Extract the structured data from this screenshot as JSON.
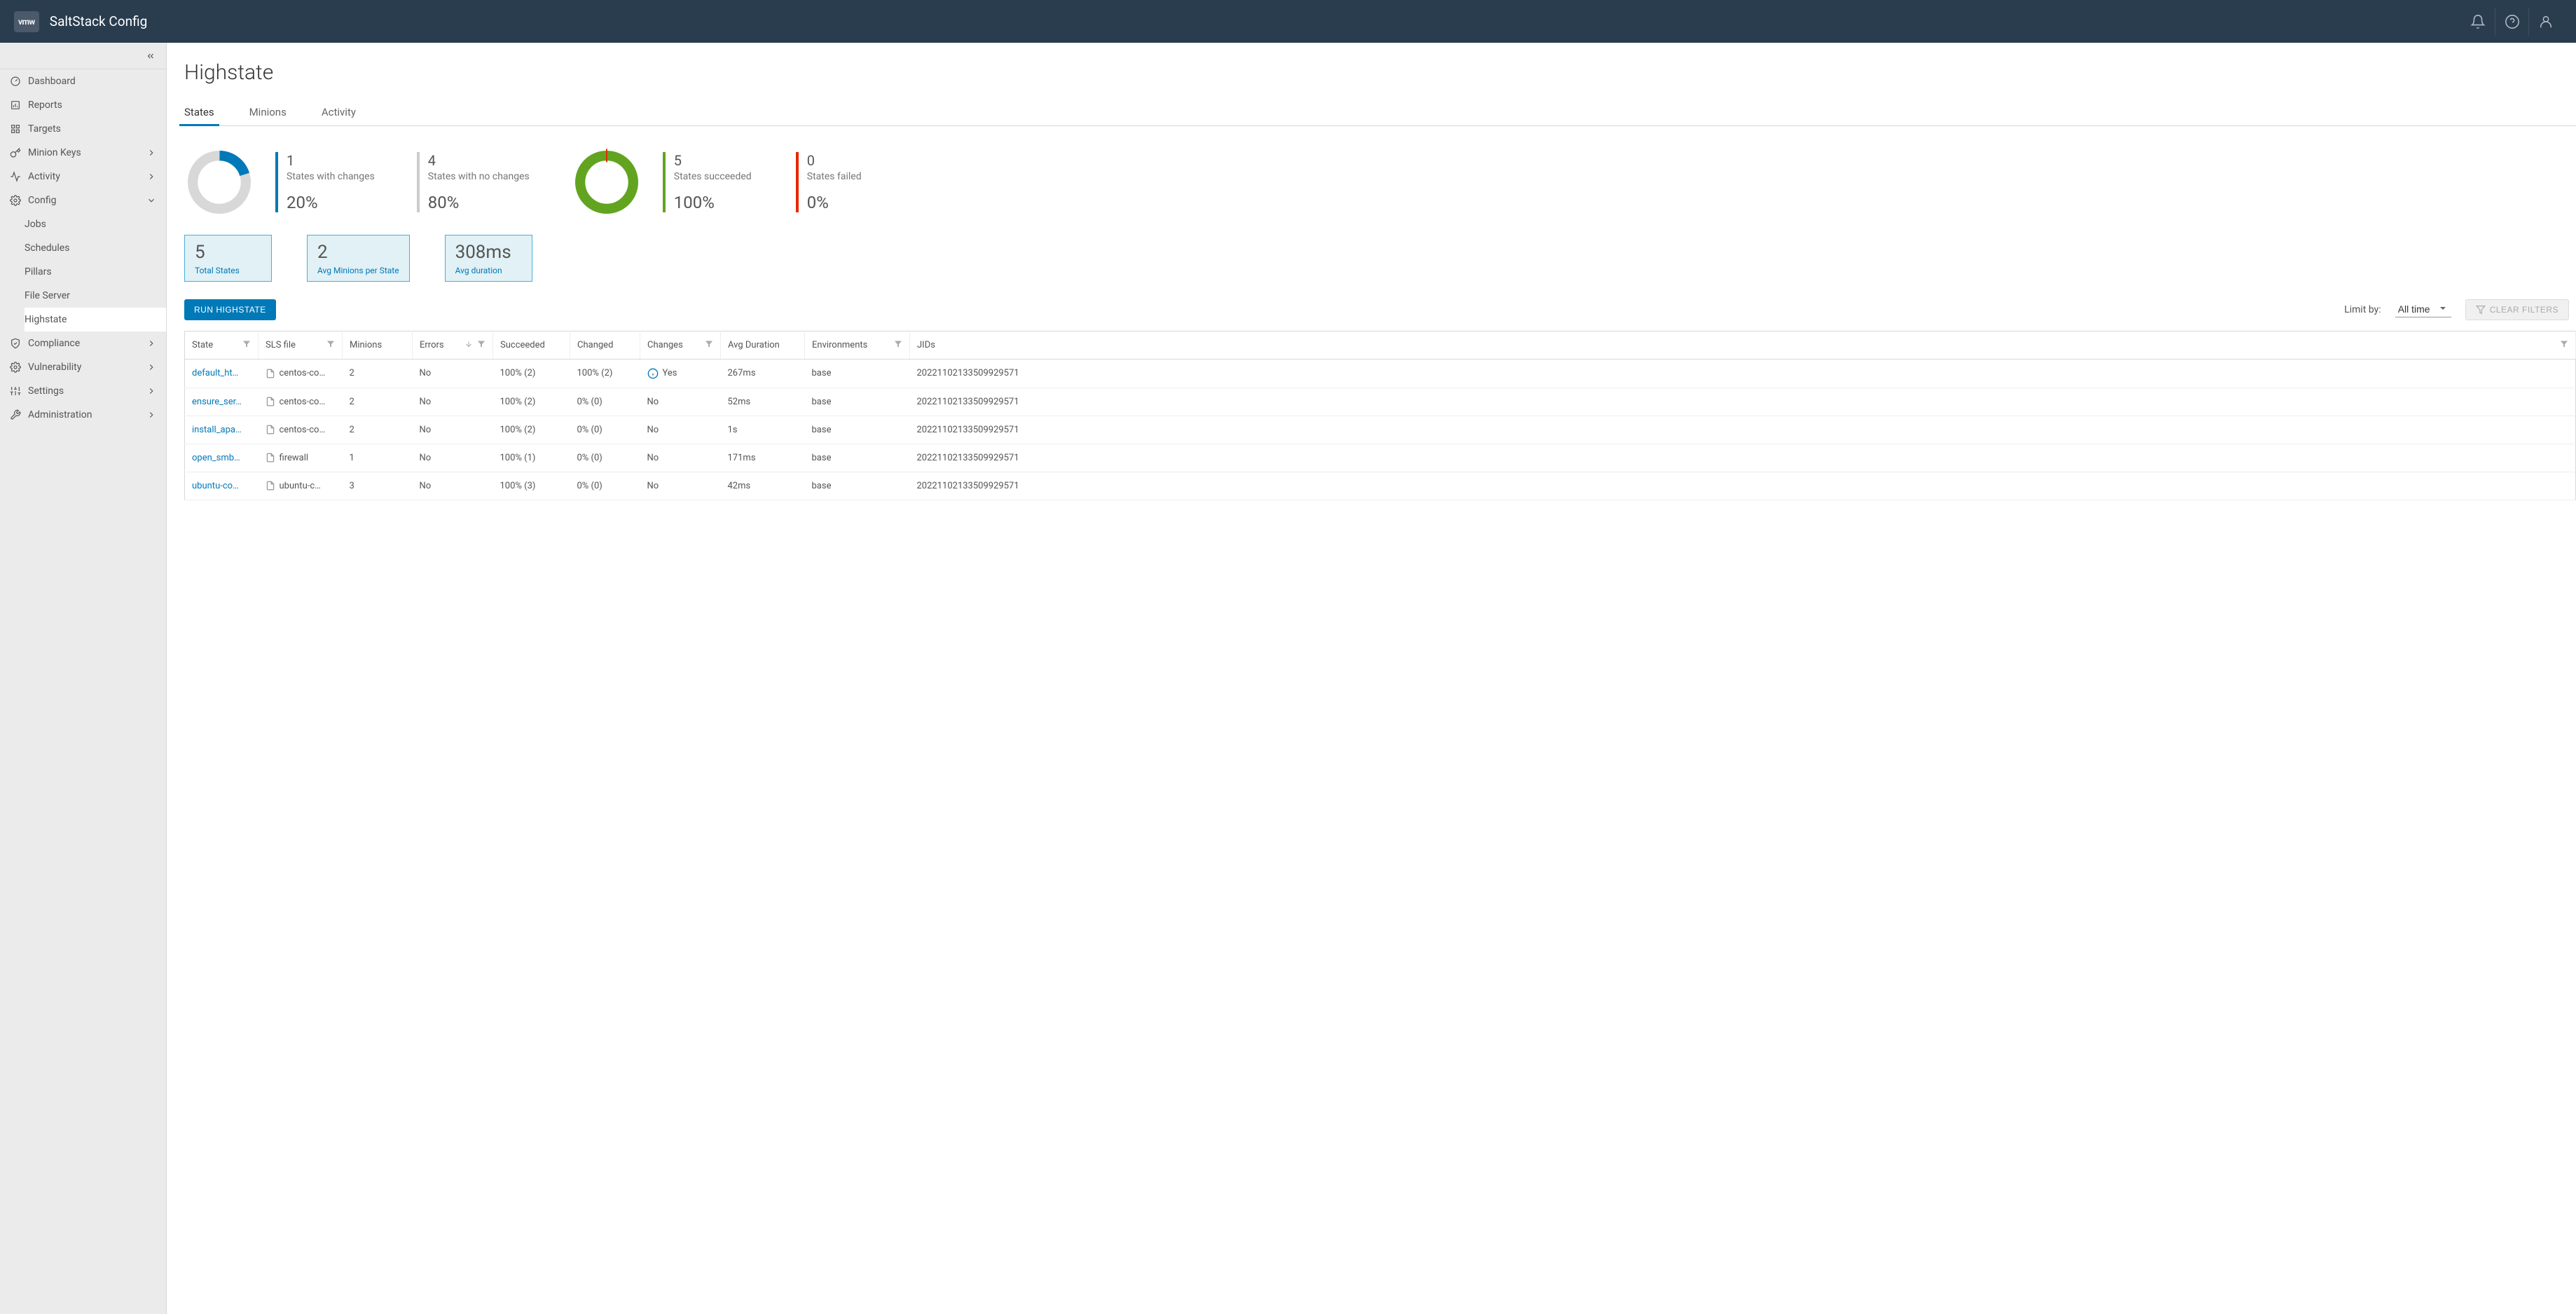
{
  "header": {
    "logo": "vmw",
    "title": "SaltStack Config"
  },
  "sidebar": {
    "items": [
      {
        "label": "Dashboard",
        "icon": "gauge"
      },
      {
        "label": "Reports",
        "icon": "report"
      },
      {
        "label": "Targets",
        "icon": "grid"
      },
      {
        "label": "Minion Keys",
        "icon": "key",
        "expandable": true
      },
      {
        "label": "Activity",
        "icon": "activity",
        "expandable": true
      },
      {
        "label": "Config",
        "icon": "cog",
        "expanded": true,
        "children": [
          {
            "label": "Jobs"
          },
          {
            "label": "Schedules"
          },
          {
            "label": "Pillars"
          },
          {
            "label": "File Server"
          },
          {
            "label": "Highstate",
            "active": true
          }
        ]
      },
      {
        "label": "Compliance",
        "icon": "shield",
        "expandable": true
      },
      {
        "label": "Vulnerability",
        "icon": "cog",
        "expandable": true
      },
      {
        "label": "Settings",
        "icon": "sliders",
        "expandable": true
      },
      {
        "label": "Administration",
        "icon": "wrench",
        "expandable": true
      }
    ]
  },
  "page": {
    "title": "Highstate"
  },
  "tabs": [
    {
      "label": "States",
      "active": true
    },
    {
      "label": "Minions"
    },
    {
      "label": "Activity"
    }
  ],
  "chart_data": [
    {
      "type": "pie",
      "title": "States changes",
      "categories": [
        "With changes",
        "No changes"
      ],
      "values": [
        1,
        4
      ],
      "percentages": [
        20,
        80
      ],
      "colors": [
        "#0079b8",
        "#d8d8d8"
      ]
    },
    {
      "type": "pie",
      "title": "States outcome",
      "categories": [
        "Succeeded",
        "Failed"
      ],
      "values": [
        5,
        0
      ],
      "percentages": [
        100,
        0
      ],
      "colors": [
        "#62a420",
        "#e62700"
      ]
    }
  ],
  "stats": {
    "changes": {
      "value": "1",
      "label": "States with changes",
      "pct": "20%"
    },
    "nochanges": {
      "value": "4",
      "label": "States with no changes",
      "pct": "80%"
    },
    "succeeded": {
      "value": "5",
      "label": "States succeeded",
      "pct": "100%"
    },
    "failed": {
      "value": "0",
      "label": "States failed",
      "pct": "0%"
    }
  },
  "summary": {
    "total_val": "5",
    "total_lbl": "Total States",
    "avg_min_val": "2",
    "avg_min_lbl": "Avg Minions per State",
    "avg_dur_val": "308ms",
    "avg_dur_lbl": "Avg duration"
  },
  "toolbar": {
    "run": "RUN HIGHSTATE",
    "limit_label": "Limit by:",
    "limit_value": "All time",
    "clear": "CLEAR FILTERS"
  },
  "table": {
    "headers": {
      "state": "State",
      "sls": "SLS file",
      "minions": "Minions",
      "errors": "Errors",
      "succeeded": "Succeeded",
      "changed": "Changed",
      "changes": "Changes",
      "duration": "Avg Duration",
      "env": "Environments",
      "jids": "JIDs"
    },
    "rows": [
      {
        "state": "default_ht…",
        "sls": "centos-co…",
        "minions": "2",
        "errors": "No",
        "succeeded": "100% (2)",
        "changed": "100% (2)",
        "changes": "Yes",
        "changes_icon": true,
        "duration": "267ms",
        "env": "base",
        "jids": "20221102133509929571"
      },
      {
        "state": "ensure_ser…",
        "sls": "centos-co…",
        "minions": "2",
        "errors": "No",
        "succeeded": "100% (2)",
        "changed": "0% (0)",
        "changes": "No",
        "duration": "52ms",
        "env": "base",
        "jids": "20221102133509929571"
      },
      {
        "state": "install_apa…",
        "sls": "centos-co…",
        "minions": "2",
        "errors": "No",
        "succeeded": "100% (2)",
        "changed": "0% (0)",
        "changes": "No",
        "duration": "1s",
        "env": "base",
        "jids": "20221102133509929571"
      },
      {
        "state": "open_smb…",
        "sls": "firewall",
        "minions": "1",
        "errors": "No",
        "succeeded": "100% (1)",
        "changed": "0% (0)",
        "changes": "No",
        "duration": "171ms",
        "env": "base",
        "jids": "20221102133509929571"
      },
      {
        "state": "ubuntu-co…",
        "sls": "ubuntu-c…",
        "minions": "3",
        "errors": "No",
        "succeeded": "100% (3)",
        "changed": "0% (0)",
        "changes": "No",
        "duration": "42ms",
        "env": "base",
        "jids": "20221102133509929571"
      }
    ]
  }
}
